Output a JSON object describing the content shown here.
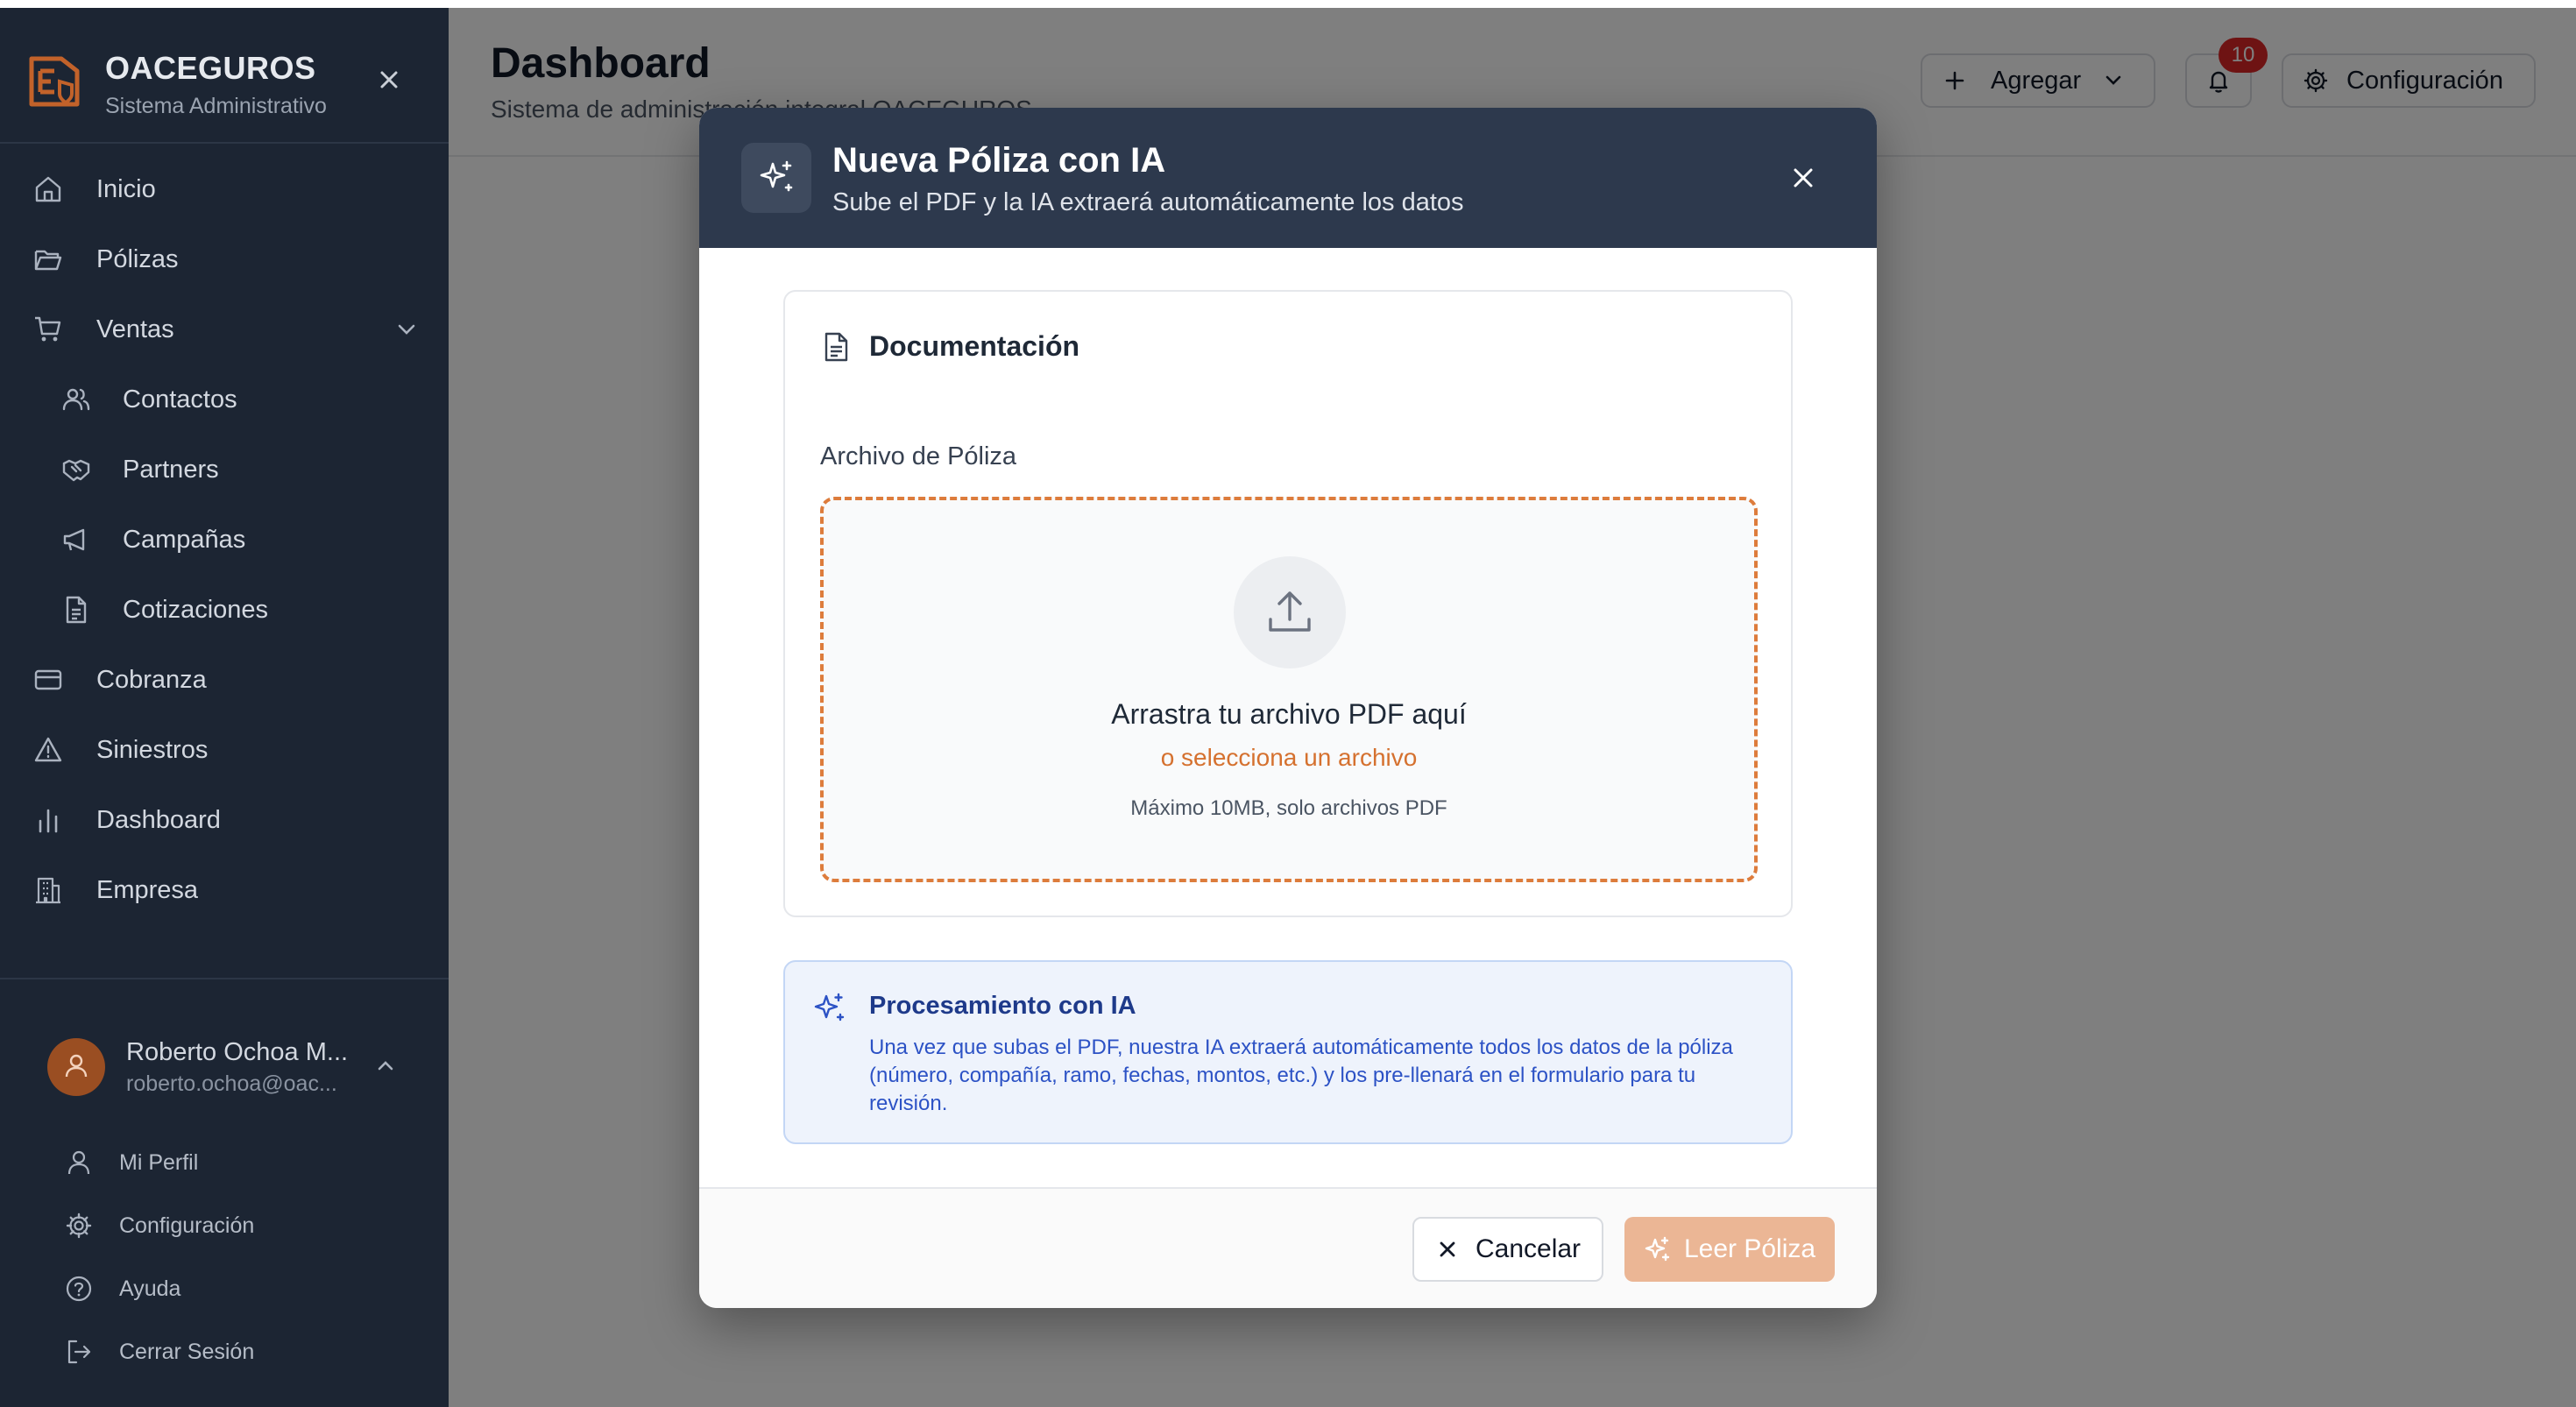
{
  "brand": {
    "name": "OACEGUROS",
    "subtitle": "Sistema Administrativo"
  },
  "nav": {
    "inicio": "Inicio",
    "polizas": "Pólizas",
    "ventas": "Ventas",
    "contactos": "Contactos",
    "partners": "Partners",
    "campanas": "Campañas",
    "cotizaciones": "Cotizaciones",
    "cobranza": "Cobranza",
    "siniestros": "Siniestros",
    "dashboard": "Dashboard",
    "empresa": "Empresa"
  },
  "user": {
    "name": "Roberto Ochoa M...",
    "email": "roberto.ochoa@oac...",
    "menu": {
      "profile": "Mi Perfil",
      "settings": "Configuración",
      "help": "Ayuda",
      "logout": "Cerrar Sesión"
    }
  },
  "header": {
    "title": "Dashboard",
    "subtitle": "Sistema de administración integral OACEGUROS",
    "add_label": "Agregar",
    "notifications_count": "10",
    "settings_label": "Configuración"
  },
  "modal": {
    "title": "Nueva Póliza con IA",
    "subtitle": "Sube el PDF y la IA extraerá automáticamente los datos",
    "section_title": "Documentación",
    "field_label": "Archivo de Póliza",
    "drop_main": "Arrastra tu archivo PDF aquí",
    "drop_link": "o selecciona un archivo",
    "drop_hint": "Máximo 10MB, solo archivos PDF",
    "ai_title": "Procesamiento con IA",
    "ai_text": "Una vez que subas el PDF, nuestra IA extraerá automáticamente todos los datos de la póliza (número, compañía, ramo, fechas, montos, etc.) y los pre-llenará en el formulario para tu revisión.",
    "cancel_label": "Cancelar",
    "read_label": "Leer Póliza"
  },
  "colors": {
    "sidebar_bg": "#1c2533",
    "modal_header_bg": "#2d394d",
    "accent_orange": "#d5712f",
    "primary_disabled": "#ebb695",
    "ai_box_bg": "#eef3fc",
    "badge_red": "#dc2626"
  }
}
